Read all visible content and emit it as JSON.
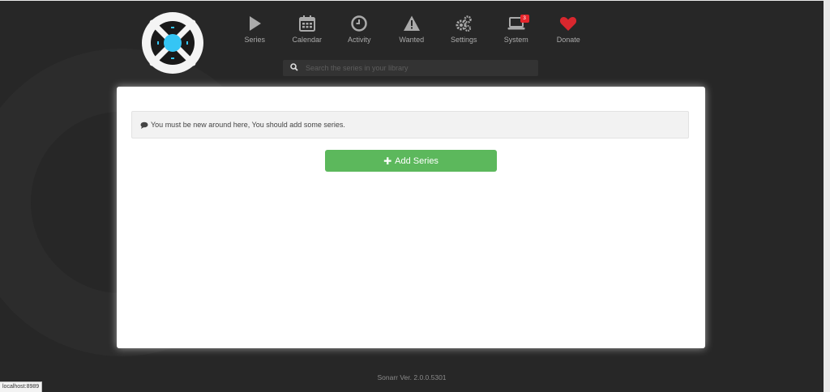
{
  "nav": {
    "items": [
      {
        "label": "Series",
        "icon": "play-icon"
      },
      {
        "label": "Calendar",
        "icon": "calendar-icon"
      },
      {
        "label": "Activity",
        "icon": "clock-icon"
      },
      {
        "label": "Wanted",
        "icon": "warning-icon"
      },
      {
        "label": "Settings",
        "icon": "gears-icon"
      },
      {
        "label": "System",
        "icon": "laptop-icon",
        "badge": "3"
      },
      {
        "label": "Donate",
        "icon": "heart-icon"
      }
    ]
  },
  "search": {
    "placeholder": "Search the series in your library",
    "value": ""
  },
  "main": {
    "alert_text": "You must be new around here, You should add some series.",
    "add_button_label": "Add Series"
  },
  "footer": {
    "version": "Sonarr Ver. 2.0.0.5301"
  },
  "statusbar": {
    "url": "localhost:8989"
  },
  "colors": {
    "background": "#272727",
    "accent_blue": "#35c5f4",
    "add_button": "#5cb85c",
    "donate_heart": "#d9272e",
    "badge": "#e6262c"
  }
}
